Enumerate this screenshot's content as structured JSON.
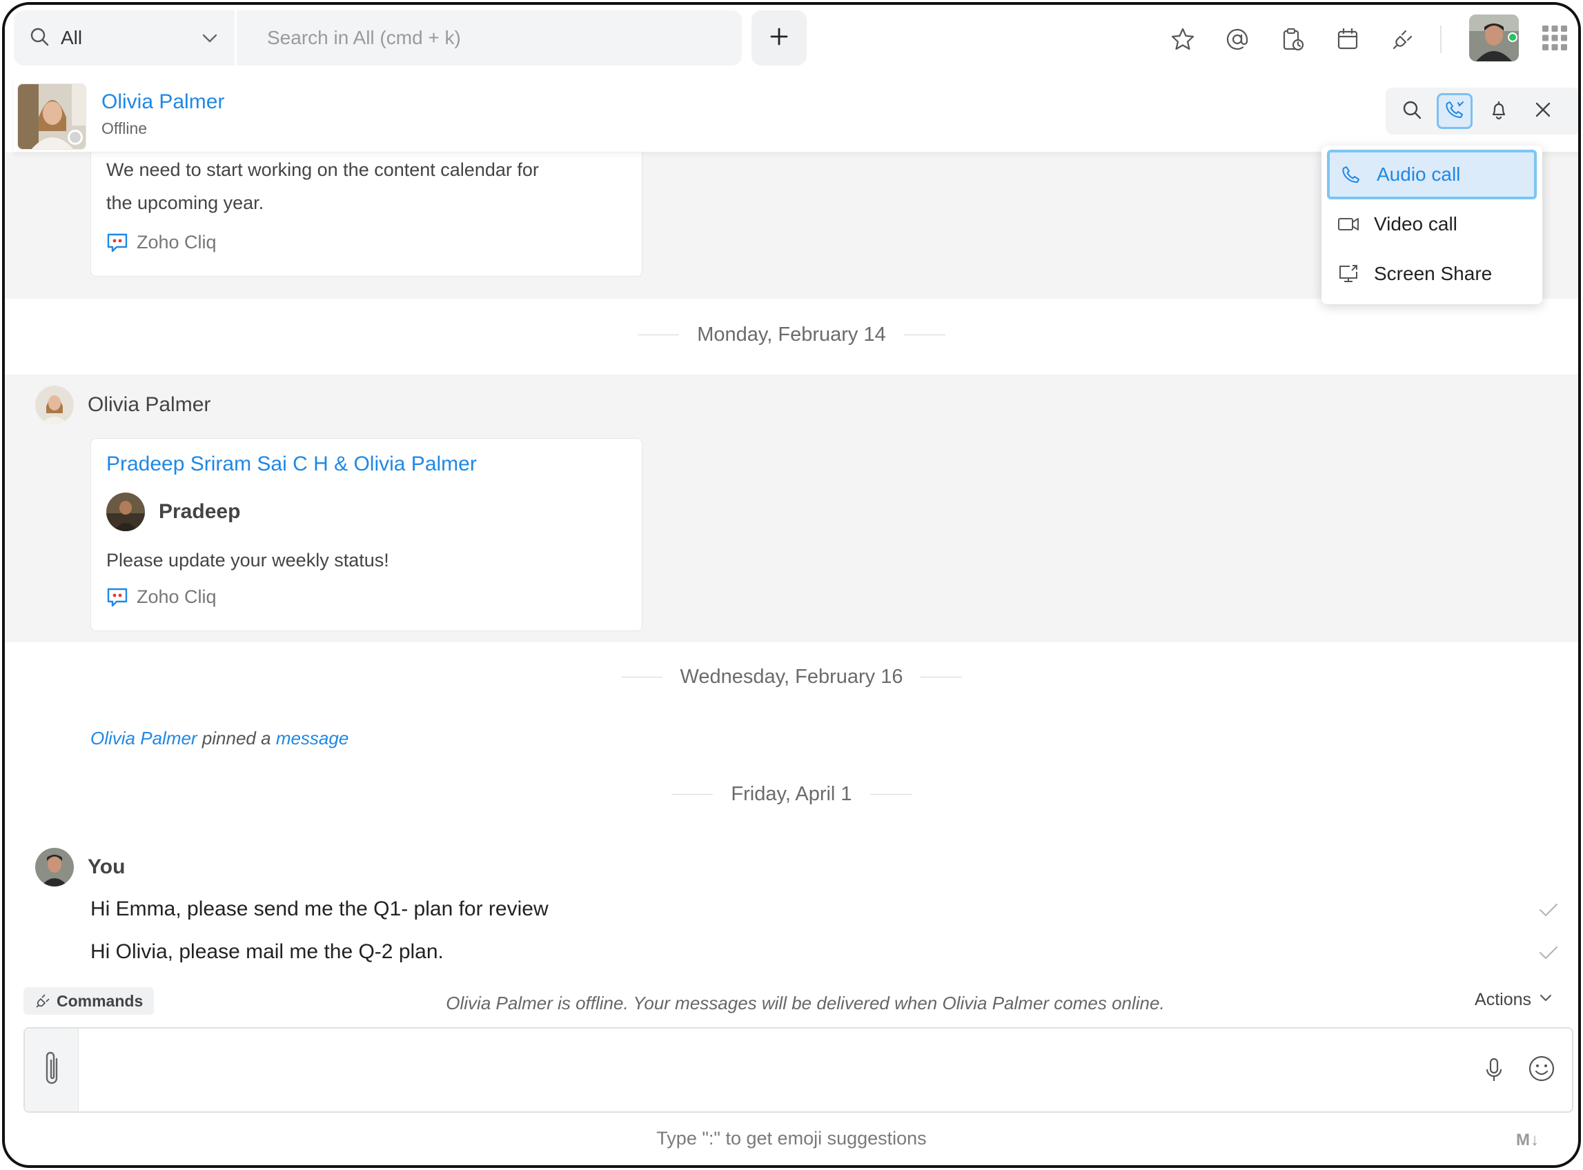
{
  "search": {
    "scope_label": "All",
    "placeholder": "Search in All (cmd + k)",
    "value": ""
  },
  "topbar": {
    "icons": [
      "plus-icon",
      "star-icon",
      "at-mention-icon",
      "reminder-icon",
      "calendar-icon",
      "integrations-plug-icon",
      "apps-grid-icon"
    ],
    "presence_color": "#22c55e"
  },
  "chat": {
    "name": "Olivia Palmer",
    "status": "Offline"
  },
  "call_menu": {
    "items": [
      {
        "label": "Audio call",
        "icon": "phone-icon"
      },
      {
        "label": "Video call",
        "icon": "video-icon"
      },
      {
        "label": "Screen Share",
        "icon": "screen-share-icon"
      }
    ],
    "selected": "Audio call"
  },
  "messages": {
    "top_card": {
      "text_line1": "We need to start working on the content calendar for",
      "text_line2": "the upcoming year.",
      "source": "Zoho Cliq"
    },
    "dates": [
      "Monday, February 14",
      "Wednesday, February 16",
      "Friday, April 1"
    ],
    "feb14": {
      "sender": "Olivia Palmer",
      "card_title": "Pradeep Sriram Sai C H & Olivia Palmer",
      "inner_sender": "Pradeep",
      "inner_text": "Please update your weekly status!",
      "source": "Zoho Cliq"
    },
    "feb16": {
      "pin_actor": "Olivia Palmer",
      "pin_verb": " pinned a ",
      "pin_object": "message"
    },
    "apr1": {
      "sender": "You",
      "lines": [
        "Hi Emma, please send me the Q1- plan for review",
        "Hi Olivia, please mail me the Q-2 plan."
      ]
    }
  },
  "composer": {
    "commands_label": "Commands",
    "offline_note": "Olivia Palmer is offline. Your messages will be delivered when Olivia Palmer comes online.",
    "actions_label": "Actions",
    "input_value": "",
    "hint": "Type \":\" to get emoji suggestions",
    "markdown_label": "M↓"
  },
  "colors": {
    "accent": "#1e88e5",
    "selection_bg": "#dcebfa",
    "selection_border": "#7cc5f2",
    "band_gray": "#f4f4f5"
  }
}
